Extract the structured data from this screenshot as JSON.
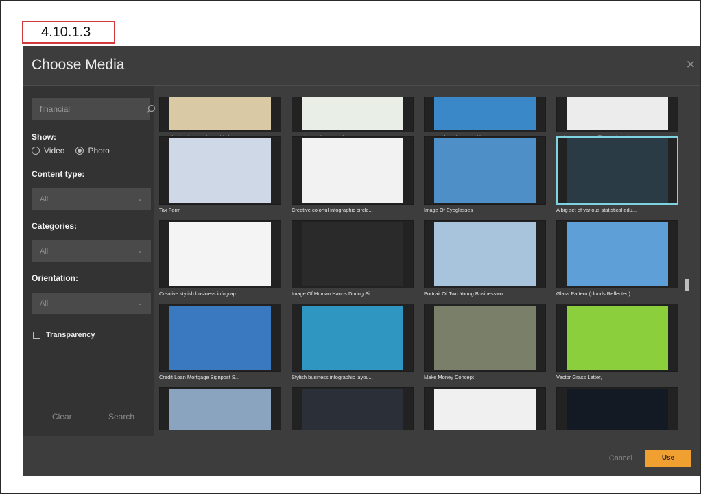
{
  "step_label": "4.10.1.3",
  "dialog": {
    "title": "Choose Media",
    "close_icon": "close-icon"
  },
  "sidebar": {
    "search": {
      "value": "financial",
      "icon": "search-icon"
    },
    "show_label": "Show:",
    "media_types": [
      {
        "label": "Video",
        "selected": false
      },
      {
        "label": "Photo",
        "selected": true
      }
    ],
    "content_type_label": "Content type:",
    "content_type_value": "All",
    "categories_label": "Categories:",
    "categories_value": "All",
    "orientation_label": "Orientation:",
    "orientation_value": "All",
    "transparency_label": "Transparency",
    "clear_label": "Clear",
    "search_label": "Search"
  },
  "media": [
    {
      "caption": "Creative business infographic layo...",
      "color": "#d9c9a4"
    },
    {
      "caption": "Creative ecology template layout...",
      "color": "#e9efe6"
    },
    {
      "caption": "Image Of Workplace With Paper A...",
      "color": "#3b88c9"
    },
    {
      "caption": "Various Poses - Office And Busine...",
      "color": "#ececec"
    },
    {
      "caption": "Tax Form",
      "color": "#cfd8e6"
    },
    {
      "caption": "Creative colorful infographic circle...",
      "color": "#f2f2f2"
    },
    {
      "caption": "Image Of Eyeglasses",
      "color": "#4f8fc8"
    },
    {
      "caption": "A big set of various statistical edu...",
      "color": "#2b3b45"
    },
    {
      "caption": "Creative stylish business infograp...",
      "color": "#f4f4f4"
    },
    {
      "caption": "Image Of Human Hands During Si...",
      "color": "#2a2a2a"
    },
    {
      "caption": "Portrait Of Two Young Businesswo...",
      "color": "#a8c3dc"
    },
    {
      "caption": "Glass Pattern (clouds Reflected)",
      "color": "#5f9fd8"
    },
    {
      "caption": "Credit Loan Mortgage Signpost S...",
      "color": "#3a78c0"
    },
    {
      "caption": "Stylish business infographic layou...",
      "color": "#2f96c2"
    },
    {
      "caption": "Make Money Concept",
      "color": "#7a7f6a"
    },
    {
      "caption": "Vector Grass Letter,",
      "color": "#8ccf3c"
    },
    {
      "caption": "",
      "color": "#8aa4c0"
    },
    {
      "caption": "",
      "color": "#2b3038"
    },
    {
      "caption": "",
      "color": "#f0f0f0"
    },
    {
      "caption": "",
      "color": "#141a24"
    }
  ],
  "selected_index": 7,
  "footer": {
    "cancel_label": "Cancel",
    "use_label": "Use"
  }
}
